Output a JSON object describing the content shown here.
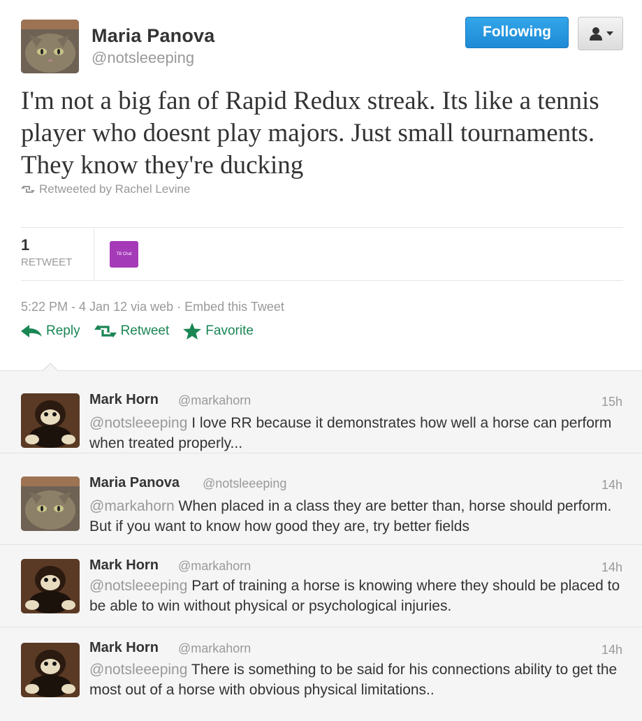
{
  "tweet": {
    "author_name": "Maria Panova",
    "author_handle": "@notsleeeping",
    "follow_label": "Following",
    "text": "I'm not a big fan of Rapid Redux streak. Its like a tennis player who doesnt play majors. Just small tournaments. They know they're ducking",
    "retweeted_by": "Retweeted by Rachel Levine",
    "retweet_count": "1",
    "retweet_label": "RETWEET",
    "retweeter_avatar_text": "TB Chat",
    "timestamp": "5:22 PM - 4 Jan 12 via web",
    "embed_label": "Embed this Tweet",
    "actions": {
      "reply": "Reply",
      "retweet": "Retweet",
      "favorite": "Favorite"
    }
  },
  "replies": [
    {
      "name": "Mark Horn",
      "handle": "@markahorn",
      "time": "15h",
      "mention": "@notsleeeping",
      "text": " I love RR because it demonstrates how well a horse can perform when treated properly..."
    },
    {
      "name": "Maria Panova",
      "handle": "@notsleeeping",
      "time": "14h",
      "mention": "@markahorn",
      "text": " When placed in a class they are better than, horse should perform. But if you want to know how good they are, try better fields"
    },
    {
      "name": "Mark Horn",
      "handle": "@markahorn",
      "time": "14h",
      "mention": "@notsleeeping",
      "text": " Part of training a horse is knowing where they should be placed to be able to win without physical or psychological injuries."
    },
    {
      "name": "Mark Horn",
      "handle": "@markahorn",
      "time": "14h",
      "mention": "@notsleeeping",
      "text": " There is something to be said for his connections ability to get the most out of a horse with obvious physical limitations.."
    }
  ],
  "colors": {
    "follow_button": "#1e8ad6",
    "action_green": "#1a8654",
    "mini_avatar": "#a53ab8"
  }
}
